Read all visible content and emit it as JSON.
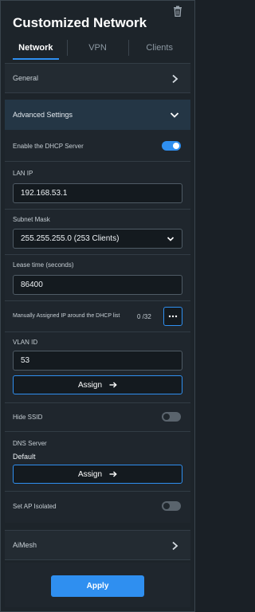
{
  "header": {
    "title": "Customized Network",
    "delete_icon": "trash-icon"
  },
  "tabs": [
    {
      "label": "Network",
      "active": true
    },
    {
      "label": "VPN",
      "active": false
    },
    {
      "label": "Clients",
      "active": false
    }
  ],
  "sections": {
    "general": "General",
    "advanced": "Advanced Settings",
    "aimesh": "AiMesh"
  },
  "dhcp": {
    "label": "Enable the DHCP Server",
    "enabled": true
  },
  "lan_ip": {
    "label": "LAN IP",
    "value": "192.168.53.1"
  },
  "subnet": {
    "label": "Subnet Mask",
    "value": "255.255.255.0 (253 Clients)"
  },
  "lease": {
    "label": "Lease time (seconds)",
    "value": "86400"
  },
  "manual_ip": {
    "label": "Manually Assigned IP around the DHCP list",
    "count": "0 /32"
  },
  "vlan": {
    "label": "VLAN ID",
    "value": "53",
    "assign": "Assign"
  },
  "hide_ssid": {
    "label": "Hide SSID",
    "enabled": false
  },
  "dns": {
    "label": "DNS Server",
    "value": "Default",
    "assign": "Assign"
  },
  "ap_isolated": {
    "label": "Set AP Isolated",
    "enabled": false
  },
  "footer": {
    "apply": "Apply"
  },
  "colors": {
    "accent": "#2f8ff0",
    "background": "#1d242a"
  }
}
